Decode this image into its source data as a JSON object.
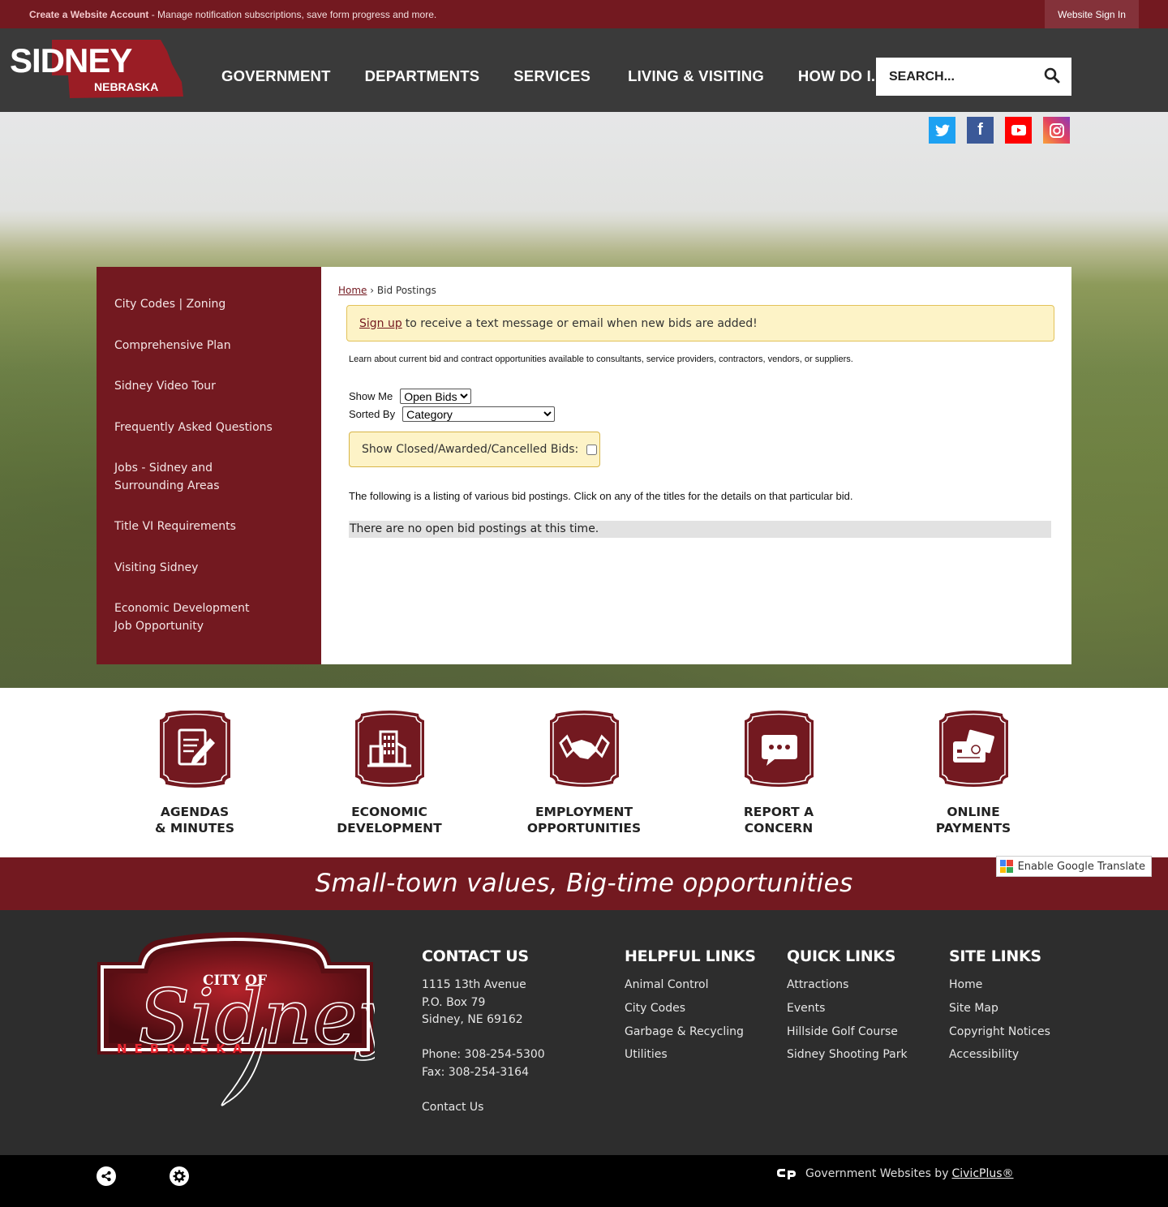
{
  "topbar": {
    "account_link": "Create a Website Account",
    "account_desc": " - Manage notification subscriptions, save form progress and more.",
    "signin": "Website Sign In"
  },
  "logo": {
    "name": "SIDNEY",
    "state": "NEBRASKA"
  },
  "nav": [
    {
      "label": "GOVERNMENT"
    },
    {
      "label": "DEPARTMENTS"
    },
    {
      "label": "SERVICES"
    },
    {
      "label": "LIVING & VISITING"
    },
    {
      "label": "HOW DO I..."
    }
  ],
  "search": {
    "placeholder": "SEARCH..."
  },
  "social": [
    {
      "name": "twitter",
      "glyph": "t"
    },
    {
      "name": "facebook",
      "glyph": "f"
    },
    {
      "name": "youtube",
      "glyph": "▶"
    },
    {
      "name": "instagram",
      "glyph": "◎"
    }
  ],
  "sidebar": {
    "items": [
      {
        "label": "City Codes | Zoning"
      },
      {
        "label": "Comprehensive Plan"
      },
      {
        "label": "Sidney Video Tour"
      },
      {
        "label": "Frequently Asked Questions"
      },
      {
        "label": "Jobs - Sidney and Surrounding Areas"
      },
      {
        "label": "Title VI Requirements"
      },
      {
        "label": "Visiting Sidney"
      },
      {
        "label": "Economic Development Job Opportunity"
      }
    ]
  },
  "content": {
    "breadcrumb": {
      "home": "Home",
      "separator": "›",
      "current": "Bid Postings"
    },
    "alert": {
      "link": "Sign up",
      "text": "to receive a text message or email when new bids are added!"
    },
    "intro": "Learn about current bid and contract opportunities available to consultants, service providers, contractors, vendors, or suppliers.",
    "show_me": {
      "label": "Show Me",
      "value": "Open Bids"
    },
    "sorted_by": {
      "label": "Sorted By",
      "value": "Category"
    },
    "closed_label": "Show Closed/Awarded/Cancelled Bids:",
    "listing_note": "The following is a listing of various bid postings. Click on any of the titles for the details on that particular bid.",
    "empty_message": "There are no open bid postings at this time."
  },
  "quick_links": [
    {
      "label": "AGENDAS\n& MINUTES",
      "icon": "document-pencil-icon"
    },
    {
      "label": "ECONOMIC\nDEVELOPMENT",
      "icon": "building-icon"
    },
    {
      "label": "EMPLOYMENT\nOPPORTUNITIES",
      "icon": "handshake-icon"
    },
    {
      "label": "REPORT A\nCONCERN",
      "icon": "chat-bubble-icon"
    },
    {
      "label": "ONLINE\nPAYMENTS",
      "icon": "credit-card-icon"
    }
  ],
  "slogan": "Small-town values, Big-time opportunities",
  "google_translate": "Enable Google Translate",
  "footer": {
    "logo": {
      "top": "CITY OF",
      "script": "Sidney",
      "state": "NEBRASKA"
    },
    "contact": {
      "title": "CONTACT US",
      "address1": "1115 13th Avenue",
      "address2": "P.O. Box 79",
      "address3": "Sidney, NE 69162",
      "phone": "Phone: 308-254-5300",
      "fax": "Fax: 308-254-3164",
      "link": "Contact Us"
    },
    "helpful": {
      "title": "HELPFUL LINKS",
      "links": [
        "Animal Control",
        "City Codes",
        "Garbage & Recycling",
        "Utilities"
      ]
    },
    "quick": {
      "title": "QUICK LINKS",
      "links": [
        "Attractions",
        "Events",
        "Hillside Golf Course",
        "Sidney Shooting Park"
      ]
    },
    "site": {
      "title": "SITE LINKS",
      "links": [
        "Home",
        "Site Map",
        "Copyright Notices",
        "Accessibility"
      ]
    }
  },
  "bottom": {
    "credit_text": "Government Websites by",
    "credit_link": "CivicPlus®"
  },
  "colors": {
    "brand": "#731920",
    "header": "#3a3a3a",
    "footer": "#2d2d2d",
    "alert_bg": "#fdf3c7"
  }
}
